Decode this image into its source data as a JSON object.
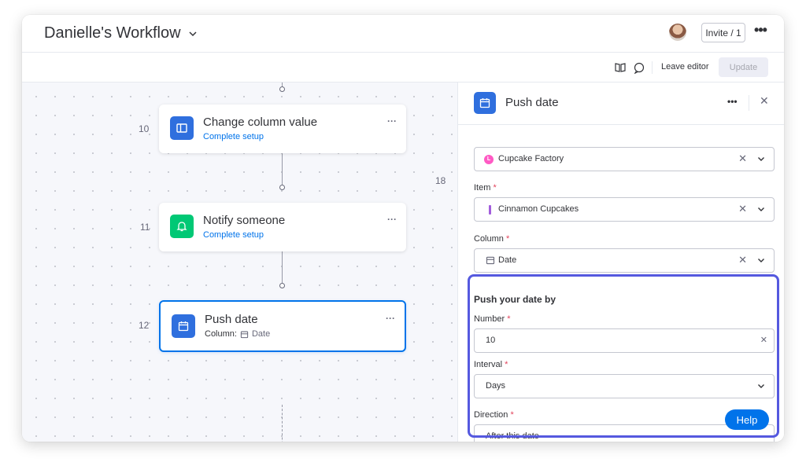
{
  "header": {
    "title": "Danielle's Workflow",
    "invite_label": "Invite / 1"
  },
  "toolbar": {
    "leave_editor_label": "Leave editor",
    "update_label": "Update"
  },
  "canvas": {
    "steps": [
      {
        "number": "10",
        "title": "Change column value",
        "subtitle": "Complete setup",
        "icon": "column-icon",
        "color": "#2f6fde"
      },
      {
        "number": "11",
        "title": "Notify someone",
        "subtitle": "Complete setup",
        "icon": "bell-icon",
        "color": "#00c875"
      },
      {
        "number": "12",
        "title": "Push date",
        "column_label": "Column:",
        "column_value": "Date",
        "icon": "calendar-icon",
        "color": "#2f6fde"
      }
    ],
    "side_number": "18",
    "add_step_glyph": "+"
  },
  "panel": {
    "title": "Push date",
    "board": {
      "value": "Cupcake Factory",
      "badge": "L"
    },
    "item": {
      "label": "Item",
      "value": "Cinnamon Cupcakes"
    },
    "column": {
      "label": "Column",
      "value": "Date"
    },
    "push_section": {
      "title": "Push your date by",
      "number_label": "Number",
      "number_value": "10",
      "interval_label": "Interval",
      "interval_value": "Days",
      "direction_label": "Direction",
      "direction_value": "After this date"
    },
    "required_mark": "*"
  },
  "help_label": "Help",
  "colors": {
    "accent": "#0073ea",
    "highlight": "#5559df",
    "required": "#e2445c"
  }
}
